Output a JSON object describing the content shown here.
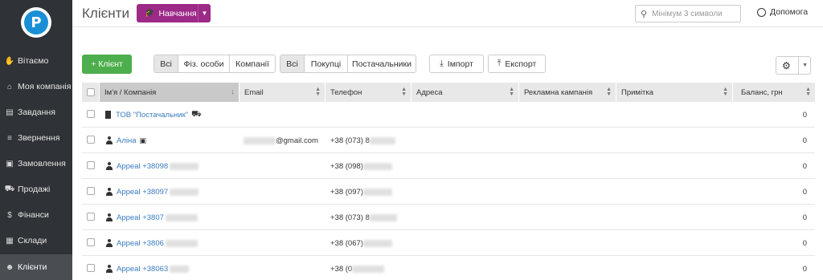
{
  "sidebar": {
    "logo_letter": "P",
    "items": [
      {
        "label": "Вітаємо",
        "icon": "hand-icon"
      },
      {
        "label": "Моя компанія",
        "icon": "home-icon"
      },
      {
        "label": "Завдання",
        "icon": "clipboard-icon"
      },
      {
        "label": "Звернення",
        "icon": "filter-icon"
      },
      {
        "label": "Замовлення",
        "icon": "order-icon"
      },
      {
        "label": "Продажі",
        "icon": "cart-icon"
      },
      {
        "label": "Фінанси",
        "icon": "coin-icon"
      },
      {
        "label": "Склади",
        "icon": "boxes-icon"
      },
      {
        "label": "Клієнти",
        "icon": "users-icon"
      }
    ]
  },
  "header": {
    "title": "Клієнти",
    "edu_button": "Навчання",
    "search_placeholder": "Мінімум 3 символи",
    "help": "Допомога"
  },
  "toolbar": {
    "add_client": "+ Клієнт",
    "type_filter": [
      "Всі",
      "Фіз. особи",
      "Компанії"
    ],
    "role_filter": [
      "Всі",
      "Покупці",
      "Постачальники"
    ],
    "import": "Імпорт",
    "export": "Експорт"
  },
  "table": {
    "columns": [
      "Ім'я / Компанія",
      "Email",
      "Телефон",
      "Адреса",
      "Рекламна кампанія",
      "Примітка",
      "Баланс, грн"
    ],
    "rows": [
      {
        "name": "ТОВ \"Постачальник\"",
        "type": "company",
        "email": "",
        "phone": "",
        "balance": "0"
      },
      {
        "name": "Аліна",
        "type": "person",
        "email": "@gmail.com",
        "phone": "+38 (073) 8",
        "balance": "0"
      },
      {
        "name": "Appeal +38098",
        "type": "person",
        "email": "",
        "phone": "+38 (098) ",
        "balance": "0"
      },
      {
        "name": "Appeal +38097",
        "type": "person",
        "email": "",
        "phone": "+38 (097) ",
        "balance": "0"
      },
      {
        "name": "Appeal +3807",
        "type": "person",
        "email": "",
        "phone": "+38 (073) 8",
        "balance": "0"
      },
      {
        "name": "Appeal +3806",
        "type": "person",
        "email": "",
        "phone": "+38 (067) ",
        "balance": "0"
      },
      {
        "name": "Appeal +38063",
        "type": "person",
        "email": "",
        "phone": "+38 (0",
        "balance": "0"
      }
    ]
  }
}
